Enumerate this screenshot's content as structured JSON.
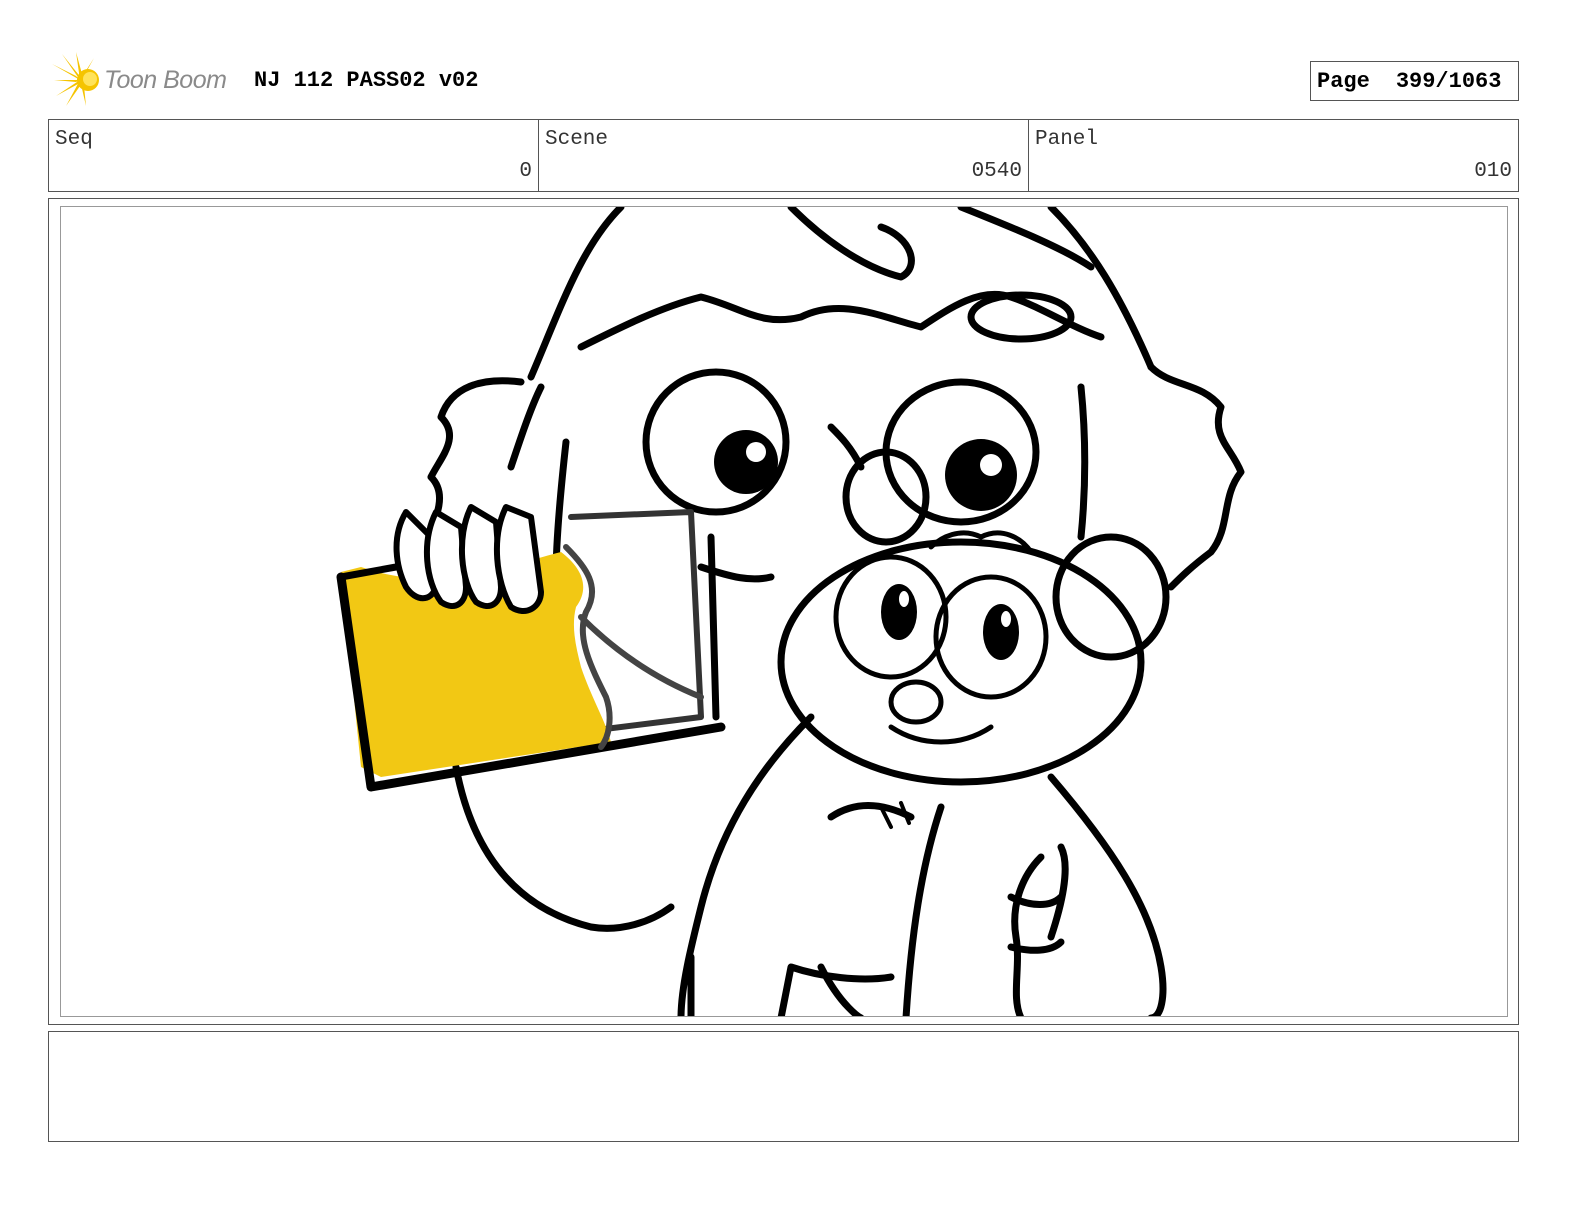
{
  "header": {
    "logo_text": "Toon Boom",
    "title": "NJ 112 PASS02 v02",
    "page_label": "Page",
    "page_number": "399/1063"
  },
  "info": {
    "seq_label": "Seq",
    "seq_value": "0",
    "scene_label": "Scene",
    "scene_value": "0540",
    "panel_label": "Panel",
    "panel_value": "010"
  },
  "notes": {
    "text": ""
  },
  "colors": {
    "logo_yellow": "#f5c400",
    "logo_gray": "#8a8a8a",
    "fill_yellow": "#f2c814",
    "ink": "#000000"
  }
}
